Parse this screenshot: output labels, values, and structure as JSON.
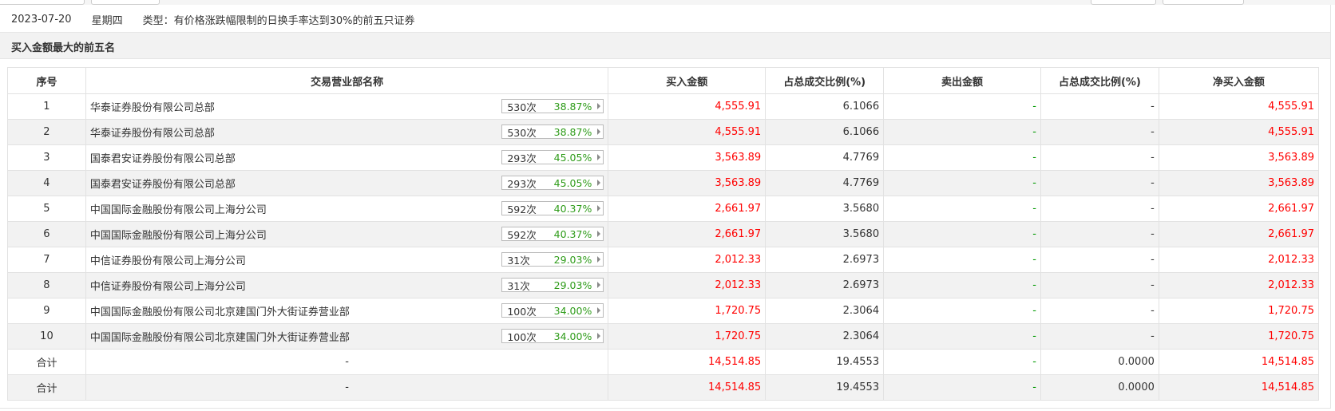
{
  "info": {
    "date": "2023-07-20",
    "weekday": "星期四",
    "type_label": "类型：",
    "type_value": "有价格涨跌幅限制的日换手率达到30%的前五只证券"
  },
  "section": {
    "title": "买入金额最大的前五名"
  },
  "table": {
    "headers": [
      "序号",
      "交易营业部名称",
      "买入金额",
      "占总成交比例(%)",
      "卖出金额",
      "占总成交比例(%)",
      "净买入金额"
    ],
    "rows": [
      {
        "idx": "1",
        "name": "华泰证券股份有限公司总部",
        "times": "530次",
        "pct": "38.87%",
        "buy": "4,555.91",
        "buy_ratio": "6.1066",
        "sell": "-",
        "sell_ratio": "-",
        "net": "4,555.91"
      },
      {
        "idx": "2",
        "name": "华泰证券股份有限公司总部",
        "times": "530次",
        "pct": "38.87%",
        "buy": "4,555.91",
        "buy_ratio": "6.1066",
        "sell": "-",
        "sell_ratio": "-",
        "net": "4,555.91"
      },
      {
        "idx": "3",
        "name": "国泰君安证券股份有限公司总部",
        "times": "293次",
        "pct": "45.05%",
        "buy": "3,563.89",
        "buy_ratio": "4.7769",
        "sell": "-",
        "sell_ratio": "-",
        "net": "3,563.89"
      },
      {
        "idx": "4",
        "name": "国泰君安证券股份有限公司总部",
        "times": "293次",
        "pct": "45.05%",
        "buy": "3,563.89",
        "buy_ratio": "4.7769",
        "sell": "-",
        "sell_ratio": "-",
        "net": "3,563.89"
      },
      {
        "idx": "5",
        "name": "中国国际金融股份有限公司上海分公司",
        "times": "592次",
        "pct": "40.37%",
        "buy": "2,661.97",
        "buy_ratio": "3.5680",
        "sell": "-",
        "sell_ratio": "-",
        "net": "2,661.97"
      },
      {
        "idx": "6",
        "name": "中国国际金融股份有限公司上海分公司",
        "times": "592次",
        "pct": "40.37%",
        "buy": "2,661.97",
        "buy_ratio": "3.5680",
        "sell": "-",
        "sell_ratio": "-",
        "net": "2,661.97"
      },
      {
        "idx": "7",
        "name": "中信证券股份有限公司上海分公司",
        "times": "31次",
        "pct": "29.03%",
        "buy": "2,012.33",
        "buy_ratio": "2.6973",
        "sell": "-",
        "sell_ratio": "-",
        "net": "2,012.33"
      },
      {
        "idx": "8",
        "name": "中信证券股份有限公司上海分公司",
        "times": "31次",
        "pct": "29.03%",
        "buy": "2,012.33",
        "buy_ratio": "2.6973",
        "sell": "-",
        "sell_ratio": "-",
        "net": "2,012.33"
      },
      {
        "idx": "9",
        "name": "中国国际金融股份有限公司北京建国门外大街证券营业部",
        "times": "100次",
        "pct": "34.00%",
        "buy": "1,720.75",
        "buy_ratio": "2.3064",
        "sell": "-",
        "sell_ratio": "-",
        "net": "1,720.75"
      },
      {
        "idx": "10",
        "name": "中国国际金融股份有限公司北京建国门外大街证券营业部",
        "times": "100次",
        "pct": "34.00%",
        "buy": "1,720.75",
        "buy_ratio": "2.3064",
        "sell": "-",
        "sell_ratio": "-",
        "net": "1,720.75"
      }
    ],
    "totals": [
      {
        "label": "合计",
        "name": "-",
        "buy": "14,514.85",
        "buy_ratio": "19.4553",
        "sell": "-",
        "sell_ratio": "0.0000",
        "net": "14,514.85"
      },
      {
        "label": "合计",
        "name": "-",
        "buy": "14,514.85",
        "buy_ratio": "19.4553",
        "sell": "-",
        "sell_ratio": "0.0000",
        "net": "14,514.85"
      }
    ]
  },
  "colors": {
    "positive": "#ff0000",
    "zero": "#009900",
    "success_pct": "#2f9c1a",
    "alt_row": "#f2f2f2"
  }
}
